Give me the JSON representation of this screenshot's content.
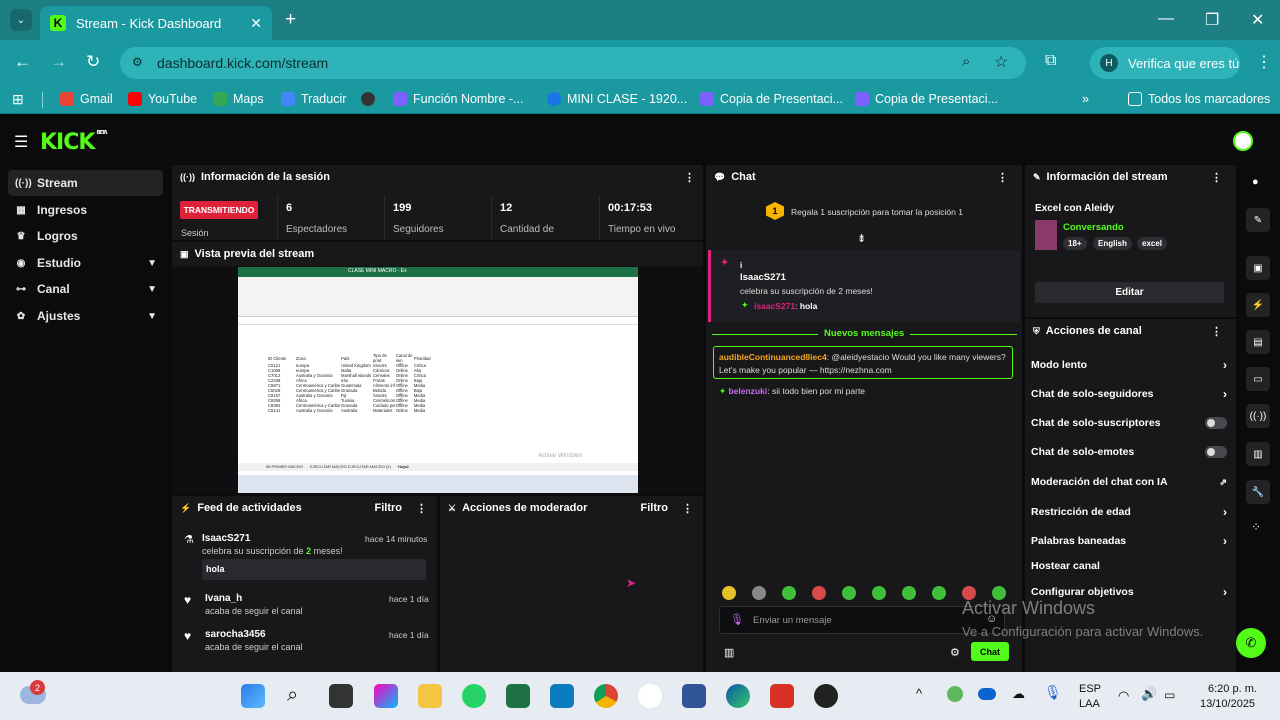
{
  "browser": {
    "tab_title": "Stream - Kick Dashboard",
    "url": "dashboard.kick.com/stream",
    "verify_label": "Verifica que eres tú",
    "verify_avatar": "H",
    "bookmarks": [
      "Gmail",
      "YouTube",
      "Maps",
      "Traducir",
      "Función Nombre -...",
      "MINI CLASE - 1920...",
      "Copia de Presentaci...",
      "Copia de Presentaci..."
    ],
    "all_bookmarks": "Todos los marcadores"
  },
  "app": {
    "logo": "KICK",
    "logo_badge": "BETA",
    "sidebar": [
      {
        "label": "Stream",
        "icon": "broadcast-icon"
      },
      {
        "label": "Ingresos",
        "icon": "revenue-icon"
      },
      {
        "label": "Logros",
        "icon": "trophy-icon"
      },
      {
        "label": "Estudio",
        "icon": "studio-icon",
        "chevron": true
      },
      {
        "label": "Canal",
        "icon": "channel-icon",
        "chevron": true
      },
      {
        "label": "Ajustes",
        "icon": "gear-icon",
        "chevron": true
      }
    ],
    "session": {
      "title": "Información de la sesión",
      "live_badge": "TRANSMITIENDO",
      "sesion_label": "Sesión",
      "stats": [
        {
          "value": "6",
          "label": "Espectadores"
        },
        {
          "value": "199",
          "label": "Seguidores"
        },
        {
          "value": "12",
          "label": "Cantidad de"
        },
        {
          "value": "00:17:53",
          "label": "Tiempo en vivo"
        }
      ]
    },
    "preview": {
      "title": "Vista previa del stream",
      "sheet_title": "CLASE MINI MACRO - Ex",
      "headers": [
        "ID Cliente",
        "Zona",
        "País",
        "Tipo de prod",
        "Canal de ven",
        "Prioridad"
      ],
      "rows": [
        [
          "C0121",
          "europa",
          "United Kingdom",
          "Snacks",
          "Offline",
          "Crítica"
        ],
        [
          "C1008",
          "europa",
          "Malta",
          "Cárnicos",
          "Online",
          "Alta"
        ],
        [
          "C7012",
          "Australia y Oceanía",
          "Marshall Islands",
          "Cereales",
          "Online",
          "Crítica"
        ],
        [
          "C2338",
          "Africa",
          "Irán",
          "Frutas",
          "Online",
          "Baja"
        ],
        [
          "C5871",
          "Centroamérica y Caribe",
          "Guatemala",
          "Alimento inf",
          "Offline",
          "Media"
        ],
        [
          "C5028",
          "Centroamérica y Caribe",
          "Granada",
          "Bebida",
          "Offline",
          "Baja"
        ],
        [
          "C9157",
          "Australia y Oceanía",
          "Fiji",
          "Snacks",
          "Offline",
          "Media"
        ],
        [
          "C8256",
          "Africa",
          "Tunisia",
          "Cosméticos",
          "Offline",
          "Media"
        ],
        [
          "C8384",
          "Centroamérica y Caribe",
          "Granada",
          "Cuidado per",
          "Offline",
          "Media"
        ],
        [
          "C8141",
          "Australia y Oceanía",
          "Australia",
          "Materiales",
          "Online",
          "Media"
        ]
      ],
      "sheet_tabs": [
        "MI PRIMER MACRO",
        "EJECUTAR MACRO",
        "EJECUTAR MACRO (2)",
        "Hoja2"
      ],
      "watermark": "Activar Windows"
    },
    "activity": {
      "title": "Feed de actividades",
      "filter": "Filtro",
      "items": [
        {
          "user": "IsaacS271",
          "time": "hace 14 minutos",
          "text_pre": "celebra su suscripción de ",
          "highlight": "2",
          "text_post": " meses!",
          "message": "hola",
          "icon": "subscription-icon"
        },
        {
          "user": "Ivana_h",
          "time": "hace 1 día",
          "text": "acaba de seguir el canal",
          "icon": "heart-icon"
        },
        {
          "user": "sarocha3456",
          "time": "hace 1 día",
          "text": "acaba de seguir el canal",
          "icon": "heart-icon"
        }
      ]
    },
    "moderator": {
      "title": "Acciones de moderador",
      "filter": "Filtro"
    },
    "chat": {
      "title": "Chat",
      "gift_rank": "1",
      "gift_text": "Regala 1 suscripción para tomar la posición 1",
      "sub_event": {
        "icon_text": "i",
        "user": "IsaacS271",
        "text": "celebra su suscripción de 2 meses!",
        "reply_user": "isaacS271",
        "reply_text": "hola"
      },
      "new_messages": "Nuevos mensajes",
      "messages": [
        {
          "user": "audibleContinuanced8iec4",
          "text": "@aleidyestacio Would you like many viewers? Let's make you popular — https://nezhna.com"
        },
        {
          "user": "belenzuki",
          "text": "sii todo bien por mi parte"
        }
      ],
      "input_placeholder": "Enviar un mensaje",
      "send_label": "Chat"
    },
    "stream_info": {
      "title": "Información del stream",
      "stream_title": "Excel con Aleidy",
      "category": "Conversando",
      "tags": [
        "18+",
        "English",
        "excel"
      ],
      "edit": "Editar"
    },
    "channel_actions": {
      "title": "Acciones de canal",
      "items": [
        {
          "label": "Modo lento",
          "control": "chevron"
        },
        {
          "label": "Chat de solo-seguidores",
          "control": "chevron"
        },
        {
          "label": "Chat de solo-suscriptores",
          "control": "toggle",
          "on": false
        },
        {
          "label": "Chat de solo-emotes",
          "control": "toggle",
          "on": false
        },
        {
          "label": "Moderación del chat con IA",
          "control": "external"
        },
        {
          "label": "Restricción de edad",
          "control": "chevron"
        },
        {
          "label": "Palabras baneadas",
          "control": "chevron"
        },
        {
          "label": "Hostear canal",
          "control": "none"
        },
        {
          "label": "Configurar objetivos",
          "control": "chevron"
        }
      ]
    },
    "activate_windows": {
      "title": "Activar Windows",
      "subtitle": "Ve a Configuración para activar Windows."
    }
  },
  "taskbar": {
    "weather_badge": "2",
    "lang": "ESP",
    "lang2": "LAA",
    "time": "6:20 p. m.",
    "date": "13/10/2025"
  },
  "colors": {
    "kick_green": "#53fc18",
    "live_red": "#e0213a",
    "browser_teal": "#1a9aa0"
  }
}
